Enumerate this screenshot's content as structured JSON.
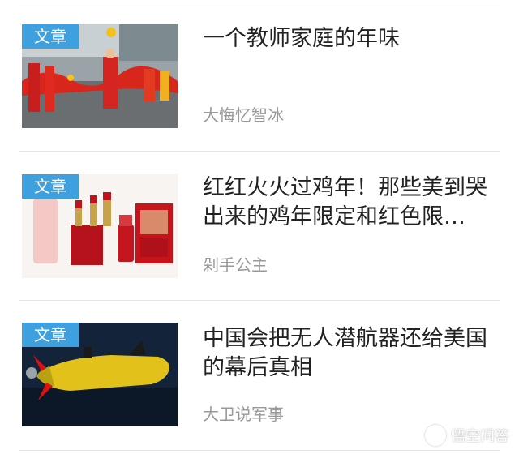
{
  "feed": {
    "items": [
      {
        "badge": "文章",
        "title": "一个教师家庭的年味",
        "author": "大悔忆智冰",
        "image": "dragon-dance-parade-photo"
      },
      {
        "badge": "文章",
        "title": "红红火火过鸡年！那些美到哭出来的鸡年限定和红色限…",
        "author": "剁手公主",
        "image": "lipstick-cosmetics-photo"
      },
      {
        "badge": "文章",
        "title": "中国会把无人潜航器还给美国的幕后真相",
        "author": "大卫说军事",
        "image": "underwater-drone-photo"
      }
    ]
  },
  "watermark": {
    "text": "悟空问答",
    "icon": "wukong-logo-icon"
  },
  "colors": {
    "badge": "#3fa0e0",
    "title": "#222222",
    "author": "#999999",
    "divider": "#e4e4e4"
  }
}
